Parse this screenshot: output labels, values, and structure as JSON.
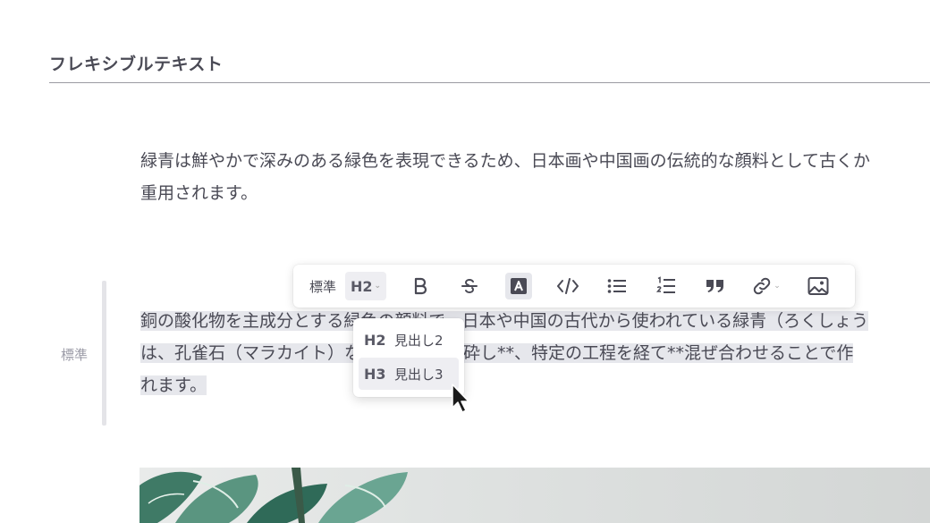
{
  "section": {
    "title": "フレキシブルテキスト"
  },
  "paragraph1": {
    "lines": [
      "緑青は鮮やかで深みのある緑色を表現できるため、日本画や中国画の伝統的な顔料として古くか",
      "重用されます。"
    ]
  },
  "block": {
    "style_label": "標準"
  },
  "paragraph2": {
    "lines": [
      "銅の酸化物を主成分とする緑色の顔料で、日本や中国の古代から使われている緑青（ろくしょう",
      "は、孔雀石（マラカイト）などの鉱石を粉砕し**、特定の工程を経て**混ぜ合わせることで作",
      "れます。"
    ]
  },
  "toolbar": {
    "style_label": "標準",
    "heading_label": "H2",
    "icons": [
      "bold-icon",
      "strikethrough-icon",
      "text-color-icon",
      "code-icon",
      "bullet-list-icon",
      "numbered-list-icon",
      "quote-icon",
      "link-icon",
      "image-icon"
    ]
  },
  "dropdown": {
    "items": [
      {
        "tag": "H2",
        "label": "見出し2"
      },
      {
        "tag": "H3",
        "label": "見出し3"
      }
    ],
    "active_index": 1
  },
  "colors": {
    "text": "#4a4a55",
    "highlight": "#e6e7ec",
    "accent_leaf": "#3f7a66"
  }
}
